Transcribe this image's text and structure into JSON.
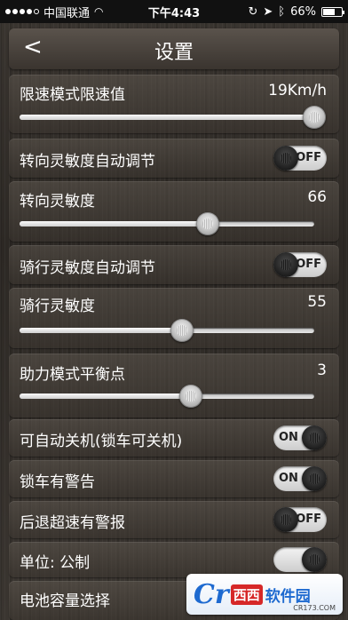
{
  "status_bar": {
    "carrier": "中国联通",
    "time": "下午4:43",
    "battery_text": "66%",
    "battery_level": 0.66,
    "signal_bars": 4
  },
  "navbar": {
    "back_label": "<",
    "title": "设置"
  },
  "settings": {
    "speed_limit": {
      "label": "限速模式限速值",
      "value": "19Km/h",
      "level": 1.0
    },
    "steer_auto": {
      "label": "转向灵敏度自动调节",
      "toggle_text": "OFF",
      "state": "off"
    },
    "steer_sens": {
      "label": "转向灵敏度",
      "value": "66",
      "level": 0.64
    },
    "ride_auto": {
      "label": "骑行灵敏度自动调节",
      "toggle_text": "OFF",
      "state": "off"
    },
    "ride_sens": {
      "label": "骑行灵敏度",
      "value": "55",
      "level": 0.55
    },
    "assist_balance": {
      "label": "助力模式平衡点",
      "value": "3",
      "level": 0.58
    },
    "auto_shutdown": {
      "label": "可自动关机(锁车可关机)",
      "toggle_text": "ON",
      "state": "on"
    },
    "lock_alarm": {
      "label": "锁车有警告",
      "toggle_text": "ON",
      "state": "on"
    },
    "reverse_alarm": {
      "label": "后退超速有警报",
      "toggle_text": "OFF",
      "state": "off"
    },
    "unit": {
      "label": "单位: 公制",
      "toggle_text": "",
      "state": "on"
    },
    "battery_select": {
      "label": "电池容量选择"
    }
  },
  "watermark": {
    "logo": "Cr",
    "brand": "西西",
    "text": "软件园",
    "url": "CR173.COM"
  }
}
